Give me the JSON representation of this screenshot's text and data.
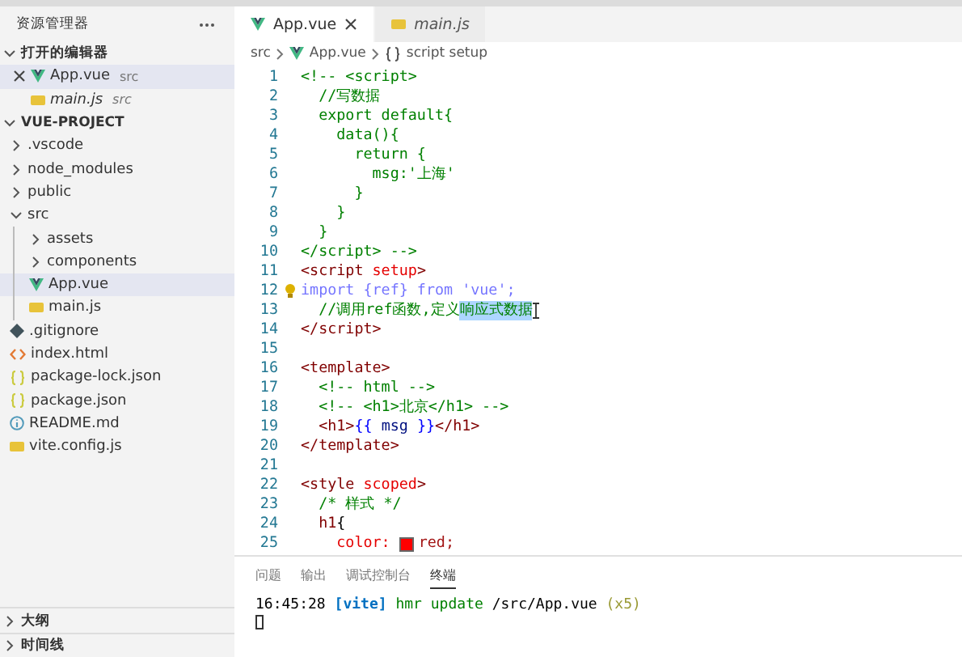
{
  "sidebar": {
    "title": "资源管理器",
    "open_editors": {
      "label": "打开的编辑器",
      "expanded": true,
      "items": [
        {
          "name": "App.vue",
          "detail": "src",
          "kind": "vue",
          "selected": true,
          "preview": false
        },
        {
          "name": "main.js",
          "detail": "src",
          "kind": "js",
          "selected": false,
          "preview": true
        }
      ]
    },
    "project": {
      "label": "VUE-PROJECT",
      "expanded": true,
      "items": [
        {
          "name": ".vscode",
          "kind": "folder",
          "expanded": false,
          "selected": false
        },
        {
          "name": "node_modules",
          "kind": "folder",
          "expanded": false,
          "selected": false
        },
        {
          "name": "public",
          "kind": "folder",
          "expanded": false,
          "selected": false
        },
        {
          "name": "src",
          "kind": "folder",
          "expanded": true,
          "selected": false,
          "children": [
            {
              "name": "assets",
              "kind": "folder",
              "expanded": false,
              "selected": false
            },
            {
              "name": "components",
              "kind": "folder",
              "expanded": false,
              "selected": false
            },
            {
              "name": "App.vue",
              "kind": "vue",
              "selected": true
            },
            {
              "name": "main.js",
              "kind": "js",
              "selected": false
            }
          ]
        },
        {
          "name": ".gitignore",
          "kind": "git",
          "selected": false
        },
        {
          "name": "index.html",
          "kind": "html",
          "selected": false
        },
        {
          "name": "package-lock.json",
          "kind": "json",
          "selected": false
        },
        {
          "name": "package.json",
          "kind": "json",
          "selected": false
        },
        {
          "name": "README.md",
          "kind": "info",
          "selected": false
        },
        {
          "name": "vite.config.js",
          "kind": "js",
          "selected": false
        }
      ]
    },
    "outline": {
      "label": "大纲",
      "expanded": false
    },
    "timeline": {
      "label": "时间线",
      "expanded": false
    }
  },
  "tabs": [
    {
      "label": "App.vue",
      "kind": "vue",
      "selected": true,
      "preview": false
    },
    {
      "label": "main.js",
      "kind": "js",
      "selected": false,
      "preview": true
    }
  ],
  "breadcrumb": [
    {
      "label": "src",
      "kind": "folder"
    },
    {
      "label": "App.vue",
      "kind": "vue"
    },
    {
      "label": "script setup",
      "kind": "symbol"
    }
  ],
  "code": [
    {
      "number": "1",
      "tokens": [
        {
          "text": "<!-- <script>",
          "kind": "comment"
        }
      ]
    },
    {
      "number": "2",
      "tokens": [
        {
          "text": "  //写数据",
          "kind": "comment"
        }
      ]
    },
    {
      "number": "3",
      "tokens": [
        {
          "text": "  export default{",
          "kind": "comment"
        }
      ]
    },
    {
      "number": "4",
      "tokens": [
        {
          "text": "    data(){",
          "kind": "comment"
        }
      ]
    },
    {
      "number": "5",
      "tokens": [
        {
          "text": "      return {",
          "kind": "comment"
        }
      ]
    },
    {
      "number": "6",
      "tokens": [
        {
          "text": "        msg:'上海'",
          "kind": "comment"
        }
      ]
    },
    {
      "number": "7",
      "tokens": [
        {
          "text": "      }",
          "kind": "comment"
        }
      ]
    },
    {
      "number": "8",
      "tokens": [
        {
          "text": "    }",
          "kind": "comment"
        }
      ]
    },
    {
      "number": "9",
      "tokens": [
        {
          "text": "  }",
          "kind": "comment"
        }
      ]
    },
    {
      "number": "10",
      "tokens": [
        {
          "text": "</script> -->",
          "kind": "comment"
        }
      ]
    },
    {
      "number": "11",
      "tokens": [
        {
          "text": "<script",
          "kind": "tag"
        },
        {
          "text": " setup",
          "kind": "attr"
        },
        {
          "text": ">",
          "kind": "tag"
        }
      ]
    },
    {
      "number": "12",
      "lightbulb": true,
      "tokens": [
        {
          "text": "import",
          "kind": "unused"
        },
        {
          "text": " {ref} from 'vue';",
          "kind": "unused"
        }
      ]
    },
    {
      "number": "13",
      "cursor": true,
      "tokens": [
        {
          "text": "  //调用ref函数,定义",
          "kind": "comment"
        },
        {
          "text": "响应式数据",
          "kind": "highlight"
        }
      ]
    },
    {
      "number": "14",
      "tokens": [
        {
          "text": "</script>",
          "kind": "tag"
        }
      ]
    },
    {
      "number": "15"
    },
    {
      "number": "16",
      "tokens": [
        {
          "text": "<template>",
          "kind": "tag"
        }
      ]
    },
    {
      "number": "17",
      "tokens": [
        {
          "text": "  <!-- html -->",
          "kind": "comment"
        }
      ]
    },
    {
      "number": "18",
      "tokens": [
        {
          "text": "  <!-- <h1>北京</h1> -->",
          "kind": "comment"
        }
      ]
    },
    {
      "number": "19",
      "tokens": [
        {
          "text": "  <h1>",
          "kind": "tag"
        },
        {
          "text": "{{ ",
          "kind": "keyword"
        },
        {
          "text": "msg",
          "kind": "var"
        },
        {
          "text": " }}",
          "kind": "keyword"
        },
        {
          "text": "</h1>",
          "kind": "tag"
        }
      ]
    },
    {
      "number": "20",
      "tokens": [
        {
          "text": "</template>",
          "kind": "tag"
        }
      ]
    },
    {
      "number": "21"
    },
    {
      "number": "22",
      "tokens": [
        {
          "text": "<style",
          "kind": "tag"
        },
        {
          "text": " scoped",
          "kind": "attr"
        },
        {
          "text": ">",
          "kind": "tag"
        }
      ]
    },
    {
      "number": "23",
      "tokens": [
        {
          "text": "  /* 样式 */",
          "kind": "comment"
        }
      ]
    },
    {
      "number": "24",
      "tokens": [
        {
          "text": "  h1",
          "kind": "tag"
        },
        {
          "text": "{",
          "kind": "text"
        }
      ]
    },
    {
      "number": "25",
      "tokens": [
        {
          "text": "    color: ",
          "kind": "attr"
        },
        {
          "text": "red;",
          "kind": "color_value",
          "color": "#ff0000"
        }
      ]
    }
  ],
  "panel": {
    "tabs": [
      {
        "label": "问题",
        "selected": false
      },
      {
        "label": "输出",
        "selected": false
      },
      {
        "label": "调试控制台",
        "selected": false
      },
      {
        "label": "终端",
        "selected": true
      }
    ],
    "terminal": [
      {
        "tokens": [
          {
            "text": "16:45:28 ",
            "kind": "text"
          },
          {
            "text": "[vite]",
            "kind": "vite"
          },
          {
            "text": " hmr update",
            "kind": "hmr"
          },
          {
            "text": " /src/App.vue ",
            "kind": "text"
          },
          {
            "text": "(x5)",
            "kind": "count"
          }
        ]
      }
    ],
    "cursor": true
  }
}
